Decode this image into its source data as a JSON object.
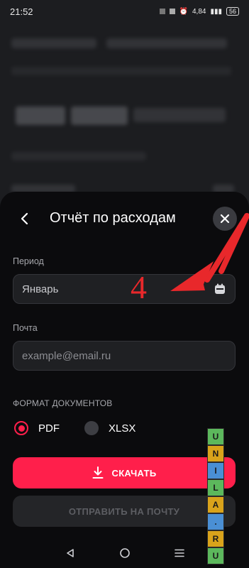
{
  "status_bar": {
    "time": "21:52",
    "network": "4,84",
    "battery": "56"
  },
  "sheet": {
    "title": "Отчёт по расходам",
    "back_icon": "chevron-left-icon",
    "close_icon": "close-icon"
  },
  "period": {
    "label": "Период",
    "value": "Январь",
    "icon": "calendar-icon"
  },
  "email": {
    "label": "Почта",
    "placeholder": "example@email.ru"
  },
  "format": {
    "title": "ФОРМАТ ДОКУМЕНТОВ",
    "options": [
      {
        "label": "PDF",
        "selected": true
      },
      {
        "label": "XLSX",
        "selected": false
      }
    ]
  },
  "actions": {
    "download_label": "СКАЧАТЬ",
    "send_label": "ОТПРАВИТЬ НА ПОЧТУ"
  },
  "annotation": {
    "number": "4"
  },
  "watermark": {
    "letters": [
      "U",
      "N",
      "I",
      "L",
      "A",
      ".",
      "R",
      "U"
    ],
    "colors": [
      "#5cb85c",
      "#d9a31b",
      "#4a8fd4",
      "#5cb85c",
      "#d9a31b",
      "#4a8fd4",
      "#d9a31b",
      "#5cb85c"
    ]
  },
  "colors": {
    "accent": "#ff1f4b",
    "sheet_bg": "#0b0b0d",
    "annotation": "#e8282b"
  }
}
